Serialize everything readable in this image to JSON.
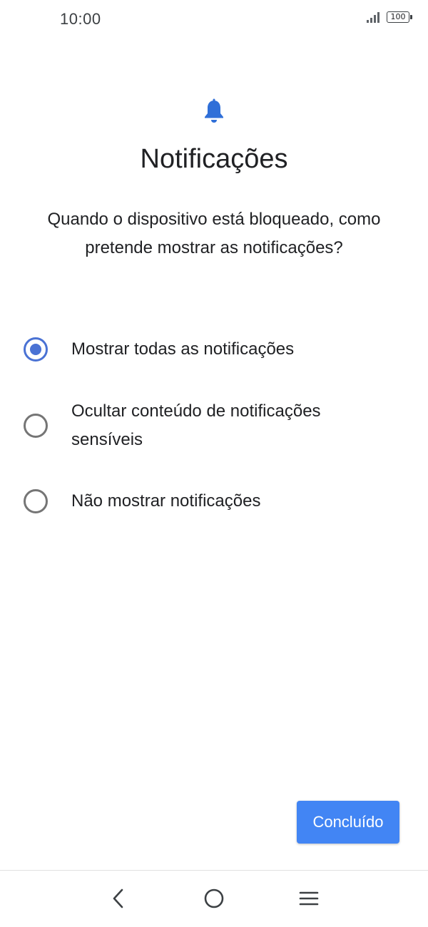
{
  "status_bar": {
    "time": "10:00",
    "battery": "100"
  },
  "header": {
    "icon": "bell-icon",
    "title": "Notificações",
    "subtitle": "Quando o dispositivo está bloqueado, como pretende mostrar as notificações?"
  },
  "options": [
    {
      "label": "Mostrar todas as notificações",
      "selected": true
    },
    {
      "label": "Ocultar conteúdo de notificações sensíveis",
      "selected": false
    },
    {
      "label": "Não mostrar notificações",
      "selected": false
    }
  ],
  "actions": {
    "done_label": "Concluído"
  },
  "nav_bar": {
    "back_icon": "back-chevron-icon",
    "home_icon": "home-circle-icon",
    "menu_icon": "menu-lines-icon"
  },
  "colors": {
    "accent": "#4a72d4",
    "button": "#4285f4",
    "bell": "#2f6fd8"
  }
}
